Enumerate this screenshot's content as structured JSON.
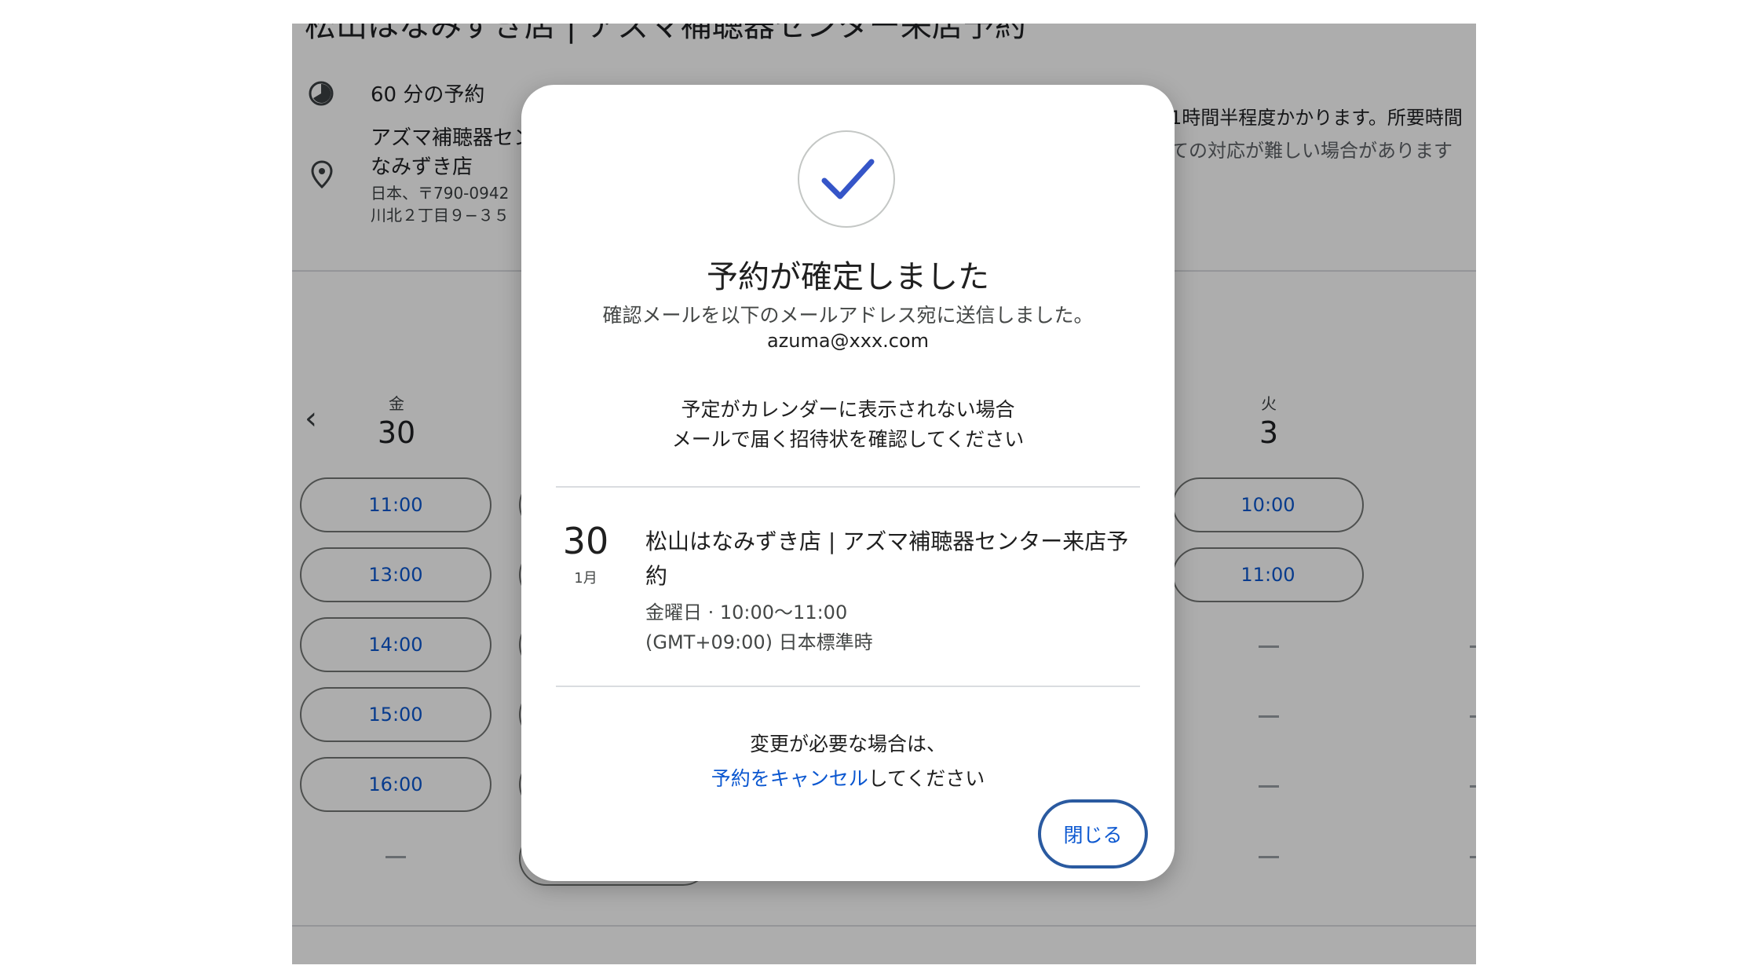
{
  "page": {
    "heading": "松山はなみずき店 | アズマ補聴器センター来店予約",
    "duration": "60 分の予約",
    "location_line1": "アズマ補聴器セン",
    "location_line2": "なみずき店",
    "address_line1": "日本、〒790-0942",
    "address_line2": "川北２丁目９−３５",
    "note_line1": "1時間半程度かかります。所要時間",
    "note_line2": "ての対応が難しい場合があります"
  },
  "calendar": {
    "prev_arrow": "‹",
    "day_fri": {
      "dow": "金",
      "date": "30",
      "slots": [
        "11:00",
        "13:00",
        "14:00",
        "15:00",
        "16:00"
      ],
      "empty": "—"
    },
    "day_tue": {
      "dow": "火",
      "date": "3",
      "slots": [
        "10:00",
        "11:00"
      ],
      "empty": "—"
    }
  },
  "dialog": {
    "title": "予約が確定しました",
    "subtitle": "確認メールを以下のメールアドレス宛に送信しました。",
    "email": "azuma@xxx.com",
    "note_line1": "予定がカレンダーに表示されない場合",
    "note_line2": "メールで届く招待状を確認してください",
    "event": {
      "day": "30",
      "month": "1月",
      "title": "松山はなみずき店 | アズマ補聴器センター来店予約",
      "time": "金曜日 · 10:00〜11:00",
      "timezone": "(GMT+09:00) 日本標準時"
    },
    "change_line1": "変更が必要な場合は、",
    "cancel_link": "予約をキャンセル",
    "change_line2_suffix": "してください",
    "close_label": "閉じる"
  },
  "colors": {
    "accent": "#0b57d0",
    "overlay": "rgba(0,0,0,0.32)"
  }
}
